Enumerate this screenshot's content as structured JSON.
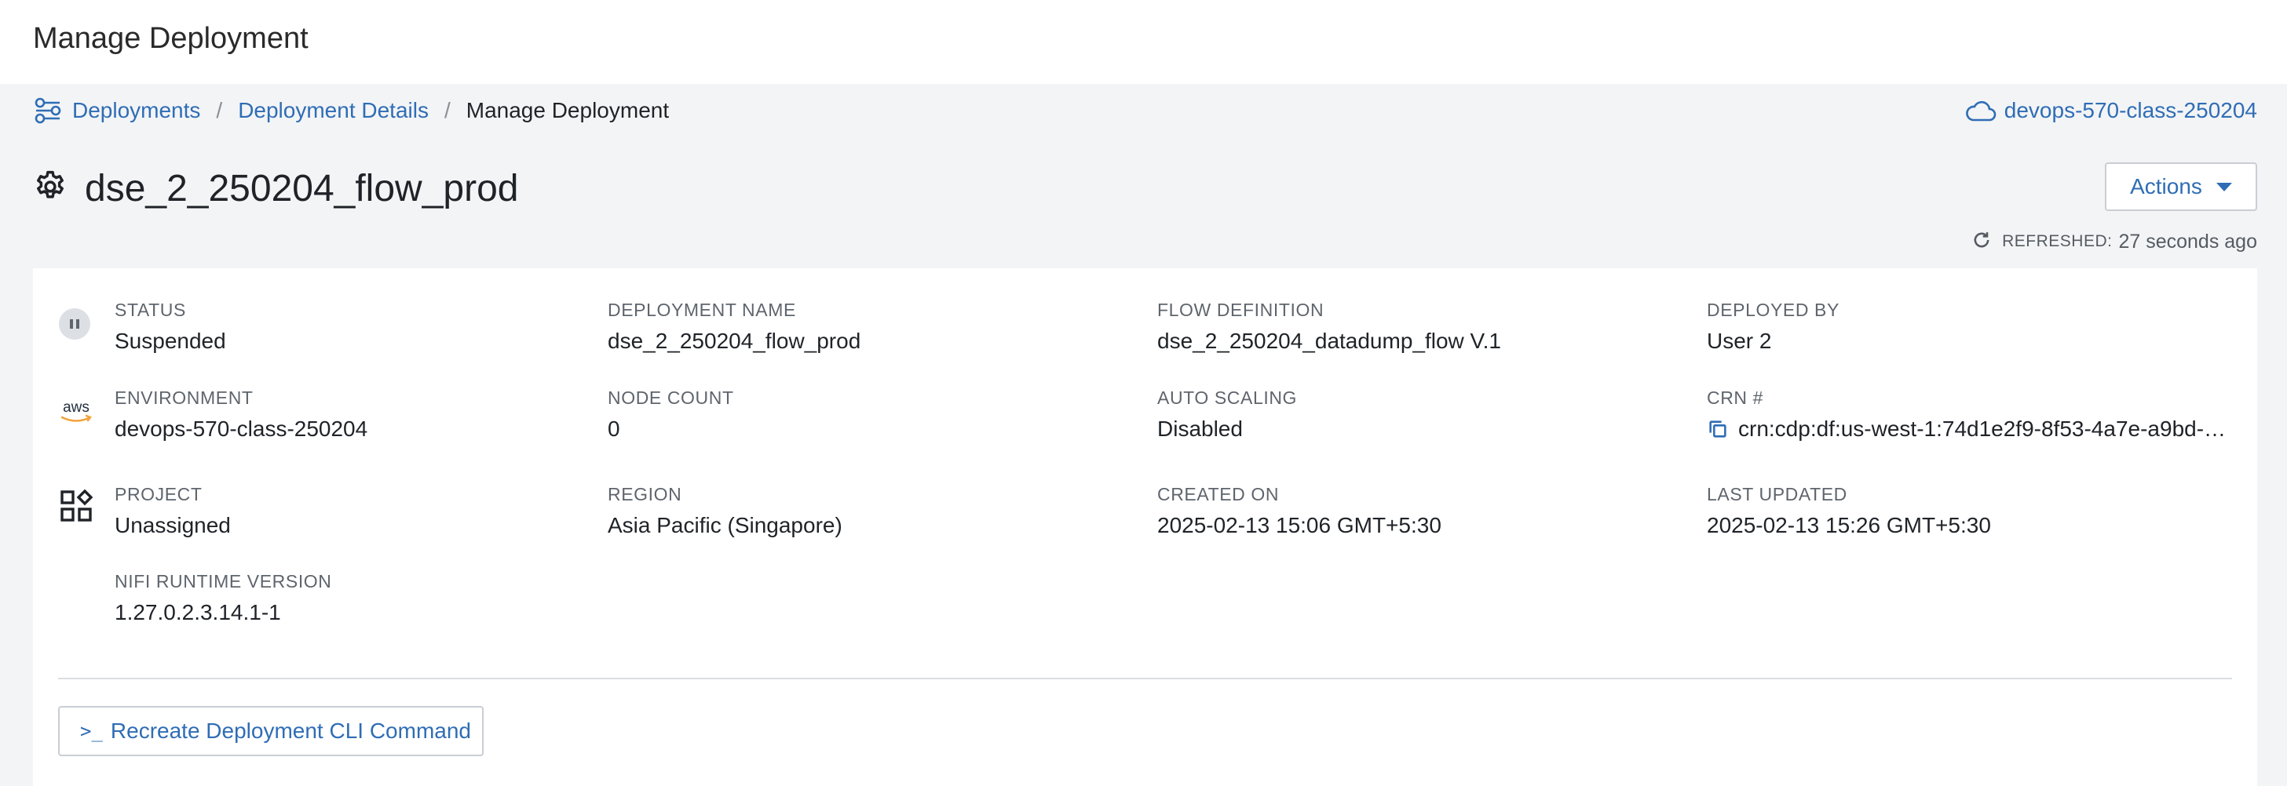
{
  "header": {
    "title": "Manage Deployment"
  },
  "breadcrumb": {
    "items": [
      "Deployments",
      "Deployment Details"
    ],
    "current": "Manage Deployment",
    "separator": "/"
  },
  "environment_link": "devops-570-class-250204",
  "page": {
    "title": "dse_2_250204_flow_prod"
  },
  "actions": {
    "label": "Actions"
  },
  "refresh": {
    "label": "REFRESHED:",
    "value": "27 seconds ago"
  },
  "details": {
    "status": {
      "label": "STATUS",
      "value": "Suspended"
    },
    "deployment_name": {
      "label": "DEPLOYMENT NAME",
      "value": "dse_2_250204_flow_prod"
    },
    "flow_definition": {
      "label": "FLOW DEFINITION",
      "value": "dse_2_250204_datadump_flow V.1"
    },
    "deployed_by": {
      "label": "DEPLOYED BY",
      "value": "User 2"
    },
    "environment": {
      "label": "ENVIRONMENT",
      "value": "devops-570-class-250204"
    },
    "node_count": {
      "label": "NODE COUNT",
      "value": "0"
    },
    "auto_scaling": {
      "label": "AUTO SCALING",
      "value": "Disabled"
    },
    "crn": {
      "label": "CRN #",
      "value": "crn:cdp:df:us-west-1:74d1e2f9-8f53-4a7e-a9bd-d..."
    },
    "project": {
      "label": "PROJECT",
      "value": "Unassigned"
    },
    "region": {
      "label": "REGION",
      "value": "Asia Pacific (Singapore)"
    },
    "created_on": {
      "label": "CREATED ON",
      "value": "2025-02-13 15:06 GMT+5:30"
    },
    "last_updated": {
      "label": "LAST UPDATED",
      "value": "2025-02-13 15:26 GMT+5:30"
    },
    "nifi_runtime": {
      "label": "NIFI RUNTIME VERSION",
      "value": "1.27.0.2.3.14.1-1"
    }
  },
  "environment_icon_text": "aws",
  "cli_button": {
    "prompt": ">_",
    "label": "Recreate Deployment CLI Command"
  },
  "colors": {
    "link": "#2f6db5",
    "text": "#1f2328",
    "muted": "#5f656d",
    "background": "#f3f4f6"
  },
  "icons": [
    "deployments-icon",
    "cloud-icon",
    "gear-icon",
    "caret-down-icon",
    "refresh-icon",
    "pause-status-icon",
    "aws-logo-icon",
    "project-grid-icon",
    "copy-icon"
  ]
}
